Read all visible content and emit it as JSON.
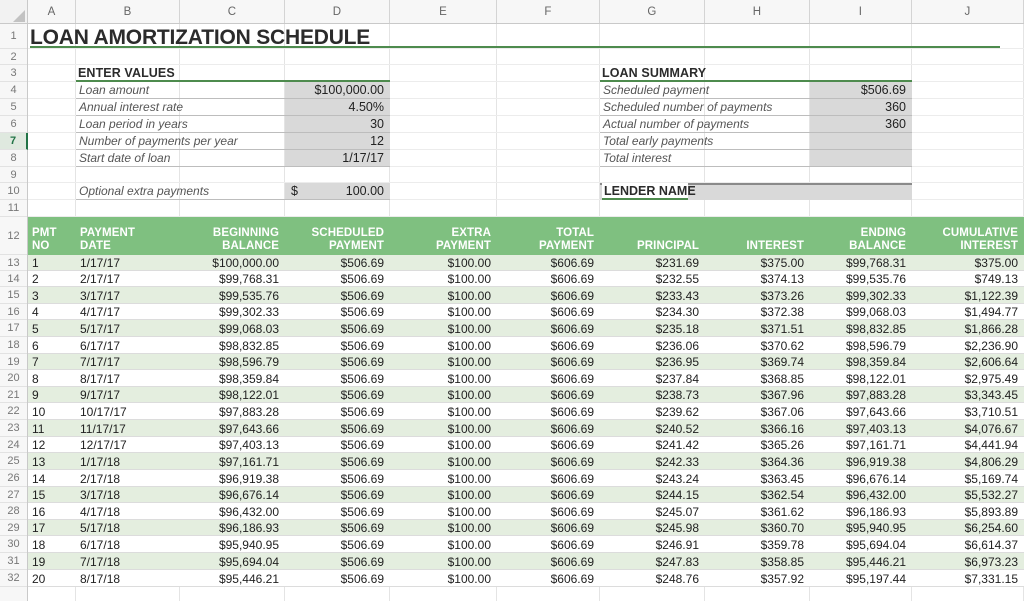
{
  "spreadsheet": {
    "column_headers": [
      "A",
      "B",
      "C",
      "D",
      "E",
      "F",
      "G",
      "H",
      "I",
      "J"
    ],
    "row_headers": [
      "1",
      "2",
      "3",
      "4",
      "5",
      "6",
      "7",
      "8",
      "9",
      "10",
      "11",
      "12",
      "13",
      "14",
      "15",
      "16",
      "17",
      "18",
      "19",
      "20",
      "21",
      "22",
      "23",
      "24",
      "25",
      "26",
      "27",
      "28",
      "29",
      "30",
      "31",
      "32"
    ],
    "selected_row": "7",
    "accent_green": "#4e8b4e",
    "header_fill": "#7fc080",
    "stripe_fill": "#e4eedf",
    "input_fill": "#d9d9d9"
  },
  "title": "LOAN AMORTIZATION SCHEDULE",
  "enter_values": {
    "heading": "ENTER VALUES",
    "rows": [
      {
        "label": "Loan amount",
        "value": "$100,000.00"
      },
      {
        "label": "Annual interest rate",
        "value": "4.50%"
      },
      {
        "label": "Loan period in years",
        "value": "30"
      },
      {
        "label": "Number of payments per year",
        "value": "12"
      },
      {
        "label": "Start date of loan",
        "value": "1/17/17"
      }
    ],
    "extra": {
      "label": "Optional extra payments",
      "currency": "$",
      "value": "100.00"
    }
  },
  "loan_summary": {
    "heading": "LOAN SUMMARY",
    "rows": [
      {
        "label": "Scheduled payment",
        "value": "$506.69"
      },
      {
        "label": "Scheduled number of payments",
        "value": "360"
      },
      {
        "label": "Actual number of payments",
        "value": "360"
      },
      {
        "label": "Total early payments",
        "value": ""
      },
      {
        "label": "Total interest",
        "value": ""
      }
    ]
  },
  "lender": {
    "heading": "LENDER NAME",
    "value": ""
  },
  "table": {
    "headers": [
      "PMT\nNO",
      "PAYMENT\nDATE",
      "BEGINNING\nBALANCE",
      "SCHEDULED\nPAYMENT",
      "EXTRA\nPAYMENT",
      "TOTAL\nPAYMENT",
      "PRINCIPAL",
      "INTEREST",
      "ENDING\nBALANCE",
      "CUMULATIVE\nINTEREST"
    ],
    "rows": [
      [
        "1",
        "1/17/17",
        "$100,000.00",
        "$506.69",
        "$100.00",
        "$606.69",
        "$231.69",
        "$375.00",
        "$99,768.31",
        "$375.00"
      ],
      [
        "2",
        "2/17/17",
        "$99,768.31",
        "$506.69",
        "$100.00",
        "$606.69",
        "$232.55",
        "$374.13",
        "$99,535.76",
        "$749.13"
      ],
      [
        "3",
        "3/17/17",
        "$99,535.76",
        "$506.69",
        "$100.00",
        "$606.69",
        "$233.43",
        "$373.26",
        "$99,302.33",
        "$1,122.39"
      ],
      [
        "4",
        "4/17/17",
        "$99,302.33",
        "$506.69",
        "$100.00",
        "$606.69",
        "$234.30",
        "$372.38",
        "$99,068.03",
        "$1,494.77"
      ],
      [
        "5",
        "5/17/17",
        "$99,068.03",
        "$506.69",
        "$100.00",
        "$606.69",
        "$235.18",
        "$371.51",
        "$98,832.85",
        "$1,866.28"
      ],
      [
        "6",
        "6/17/17",
        "$98,832.85",
        "$506.69",
        "$100.00",
        "$606.69",
        "$236.06",
        "$370.62",
        "$98,596.79",
        "$2,236.90"
      ],
      [
        "7",
        "7/17/17",
        "$98,596.79",
        "$506.69",
        "$100.00",
        "$606.69",
        "$236.95",
        "$369.74",
        "$98,359.84",
        "$2,606.64"
      ],
      [
        "8",
        "8/17/17",
        "$98,359.84",
        "$506.69",
        "$100.00",
        "$606.69",
        "$237.84",
        "$368.85",
        "$98,122.01",
        "$2,975.49"
      ],
      [
        "9",
        "9/17/17",
        "$98,122.01",
        "$506.69",
        "$100.00",
        "$606.69",
        "$238.73",
        "$367.96",
        "$97,883.28",
        "$3,343.45"
      ],
      [
        "10",
        "10/17/17",
        "$97,883.28",
        "$506.69",
        "$100.00",
        "$606.69",
        "$239.62",
        "$367.06",
        "$97,643.66",
        "$3,710.51"
      ],
      [
        "11",
        "11/17/17",
        "$97,643.66",
        "$506.69",
        "$100.00",
        "$606.69",
        "$240.52",
        "$366.16",
        "$97,403.13",
        "$4,076.67"
      ],
      [
        "12",
        "12/17/17",
        "$97,403.13",
        "$506.69",
        "$100.00",
        "$606.69",
        "$241.42",
        "$365.26",
        "$97,161.71",
        "$4,441.94"
      ],
      [
        "13",
        "1/17/18",
        "$97,161.71",
        "$506.69",
        "$100.00",
        "$606.69",
        "$242.33",
        "$364.36",
        "$96,919.38",
        "$4,806.29"
      ],
      [
        "14",
        "2/17/18",
        "$96,919.38",
        "$506.69",
        "$100.00",
        "$606.69",
        "$243.24",
        "$363.45",
        "$96,676.14",
        "$5,169.74"
      ],
      [
        "15",
        "3/17/18",
        "$96,676.14",
        "$506.69",
        "$100.00",
        "$606.69",
        "$244.15",
        "$362.54",
        "$96,432.00",
        "$5,532.27"
      ],
      [
        "16",
        "4/17/18",
        "$96,432.00",
        "$506.69",
        "$100.00",
        "$606.69",
        "$245.07",
        "$361.62",
        "$96,186.93",
        "$5,893.89"
      ],
      [
        "17",
        "5/17/18",
        "$96,186.93",
        "$506.69",
        "$100.00",
        "$606.69",
        "$245.98",
        "$360.70",
        "$95,940.95",
        "$6,254.60"
      ],
      [
        "18",
        "6/17/18",
        "$95,940.95",
        "$506.69",
        "$100.00",
        "$606.69",
        "$246.91",
        "$359.78",
        "$95,694.04",
        "$6,614.37"
      ],
      [
        "19",
        "7/17/18",
        "$95,694.04",
        "$506.69",
        "$100.00",
        "$606.69",
        "$247.83",
        "$358.85",
        "$95,446.21",
        "$6,973.23"
      ],
      [
        "20",
        "8/17/18",
        "$95,446.21",
        "$506.69",
        "$100.00",
        "$606.69",
        "$248.76",
        "$357.92",
        "$95,197.44",
        "$7,331.15"
      ]
    ]
  }
}
